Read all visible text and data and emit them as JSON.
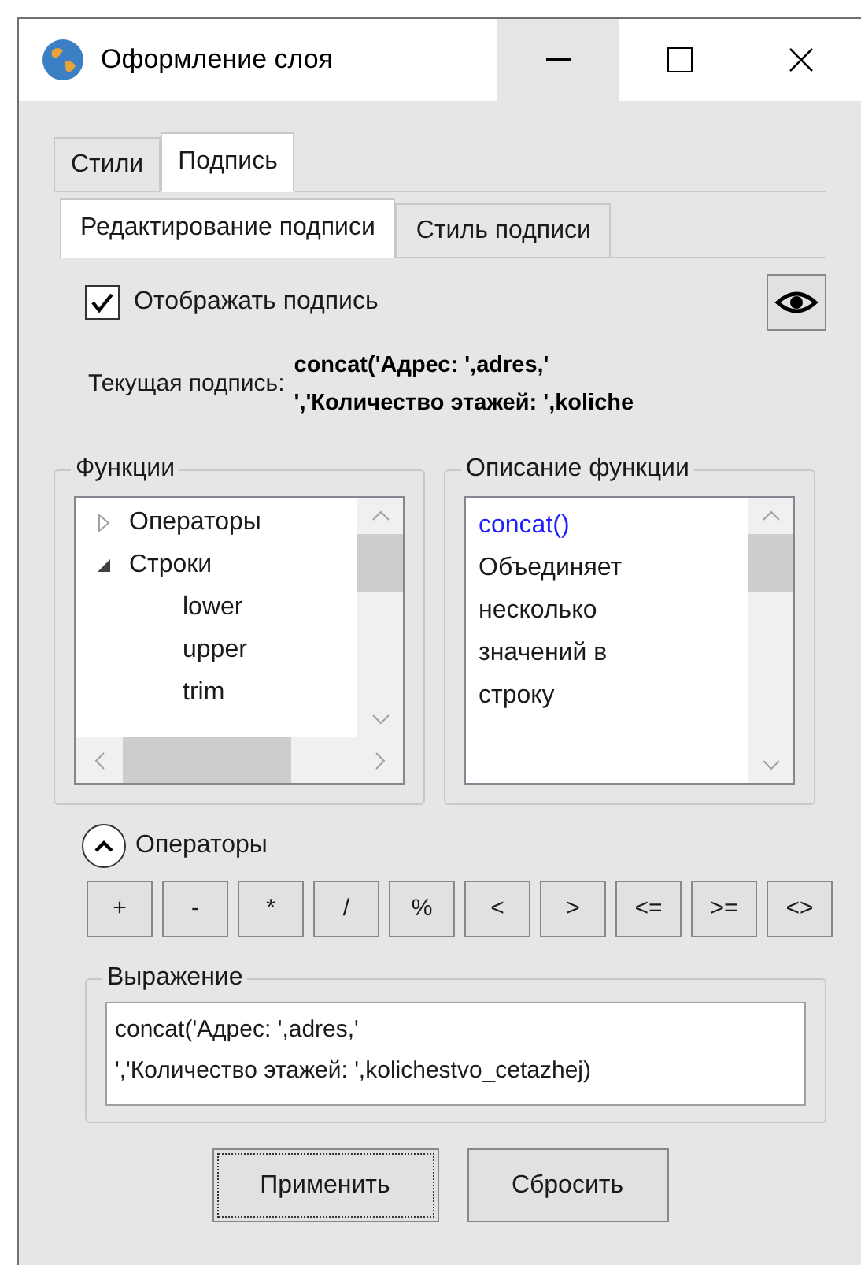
{
  "window": {
    "title": "Оформление слоя"
  },
  "tabs": [
    {
      "label": "Стили",
      "selected": false
    },
    {
      "label": "Подпись",
      "selected": true
    }
  ],
  "subtabs": [
    {
      "label": "Редактирование подписи",
      "selected": true
    },
    {
      "label": "Стиль подписи",
      "selected": false
    }
  ],
  "show_label": {
    "label": "Отображать подпись",
    "checked": true
  },
  "current_label": {
    "label": "Текущая подпись:",
    "lines": [
      "concat('Адрес: ',adres,'",
      "','Количество этажей: ',koliche"
    ]
  },
  "functions": {
    "title": "Функции",
    "tree": [
      {
        "label": "Операторы",
        "expanded": false
      },
      {
        "label": "Строки",
        "expanded": true,
        "children": [
          {
            "label": "lower"
          },
          {
            "label": "upper"
          },
          {
            "label": "trim"
          }
        ]
      }
    ]
  },
  "description": {
    "title": "Описание функции",
    "name": "concat()",
    "text": "Объединяет несколько значений в строку"
  },
  "operators": {
    "label": "Операторы",
    "expanded": true,
    "buttons": [
      "+",
      "-",
      "*",
      "/",
      "%",
      "<",
      ">",
      "<=",
      ">=",
      "<>"
    ]
  },
  "expression": {
    "title": "Выражение",
    "value": "concat('Адрес: ',adres,'\n','Количество этажей: ',kolichestvo_cetazhej)"
  },
  "buttons": [
    {
      "label": "Применить",
      "focused": true
    },
    {
      "label": "Сбросить",
      "focused": false
    }
  ]
}
